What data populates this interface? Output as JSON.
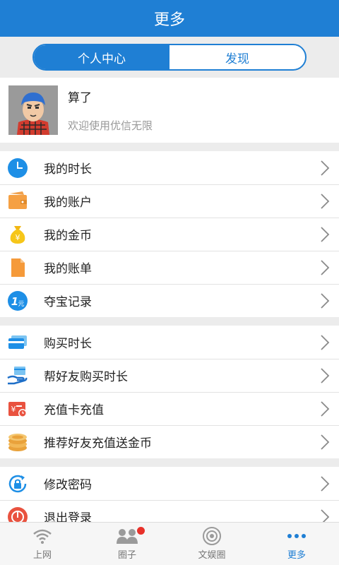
{
  "header": {
    "title": "更多"
  },
  "segment": {
    "tabs": [
      {
        "label": "个人中心",
        "active": true
      },
      {
        "label": "发现",
        "active": false
      }
    ]
  },
  "profile": {
    "name": "算了",
    "subtitle": "欢迎使用优信无限"
  },
  "group1": [
    {
      "label": "我的时长",
      "icon": "clock-icon"
    },
    {
      "label": "我的账户",
      "icon": "wallet-icon"
    },
    {
      "label": "我的金币",
      "icon": "money-bag-icon"
    },
    {
      "label": "我的账单",
      "icon": "bill-icon"
    },
    {
      "label": "夺宝记录",
      "icon": "one-yuan-icon"
    }
  ],
  "group2": [
    {
      "label": "购买时长",
      "icon": "card-icon"
    },
    {
      "label": "帮好友购买时长",
      "icon": "gift-hand-icon"
    },
    {
      "label": "充值卡充值",
      "icon": "recharge-card-icon"
    },
    {
      "label": "推荐好友充值送金币",
      "icon": "coin-stack-icon"
    }
  ],
  "group3": [
    {
      "label": "修改密码",
      "icon": "lock-refresh-icon"
    },
    {
      "label": "退出登录",
      "icon": "logout-icon"
    }
  ],
  "tabbar": [
    {
      "label": "上网",
      "icon": "wifi-icon",
      "active": false
    },
    {
      "label": "圈子",
      "icon": "people-icon",
      "active": false,
      "badge": true
    },
    {
      "label": "文娱圈",
      "icon": "radar-icon",
      "active": false
    },
    {
      "label": "更多",
      "icon": "more-dots-icon",
      "active": true
    }
  ],
  "colors": {
    "primary": "#1f7fd4",
    "badge": "#e8312a"
  }
}
